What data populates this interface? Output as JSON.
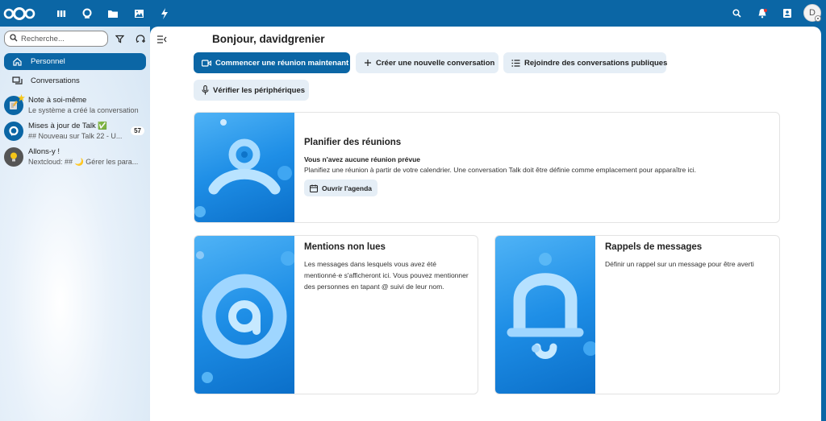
{
  "header": {
    "apps": [
      "dashboard-icon",
      "talk-icon",
      "files-icon",
      "photos-icon",
      "activity-icon"
    ],
    "avatar_initial": "D"
  },
  "sidebar": {
    "search_placeholder": "Recherche...",
    "nav": [
      {
        "label": "Personnel",
        "active": true
      },
      {
        "label": "Conversations",
        "active": false
      }
    ],
    "conversations": [
      {
        "name": "Note à soi-même",
        "sub": "Le système a créé la conversation",
        "badge": ""
      },
      {
        "name": "Mises à jour de Talk ✅",
        "sub": "## Nouveau sur Talk 22 - U...",
        "badge": "57"
      },
      {
        "name": "Allons-y !",
        "sub": "Nextcloud: ## 🌙 Gérer les para...",
        "badge": ""
      }
    ]
  },
  "main": {
    "greeting": "Bonjour, davidgrenier",
    "buttons": {
      "start_meeting": "Commencer une réunion maintenant",
      "new_conversation": "Créer une nouvelle conversation",
      "join_public": "Rejoindre des conversations publiques",
      "check_devices": "Vérifier les périphériques"
    },
    "cards": {
      "meetings": {
        "title": "Planifier des réunions",
        "subtitle": "Vous n'avez aucune réunion prévue",
        "text": "Planifiez une réunion à partir de votre calendrier. Une conversation Talk doit être définie comme emplacement pour apparaître ici.",
        "button": "Ouvrir l'agenda"
      },
      "mentions": {
        "title": "Mentions non lues",
        "text": "Les messages dans lesquels vous avez été mentionné·e s'afficheront ici. Vous pouvez mentionner des personnes en tapant @ suivi de leur nom."
      },
      "reminders": {
        "title": "Rappels de messages",
        "text": "Définir un rappel sur un message pour être averti"
      }
    }
  },
  "colors": {
    "brand": "#0b66a5",
    "secondary_button": "#e5eef6"
  }
}
